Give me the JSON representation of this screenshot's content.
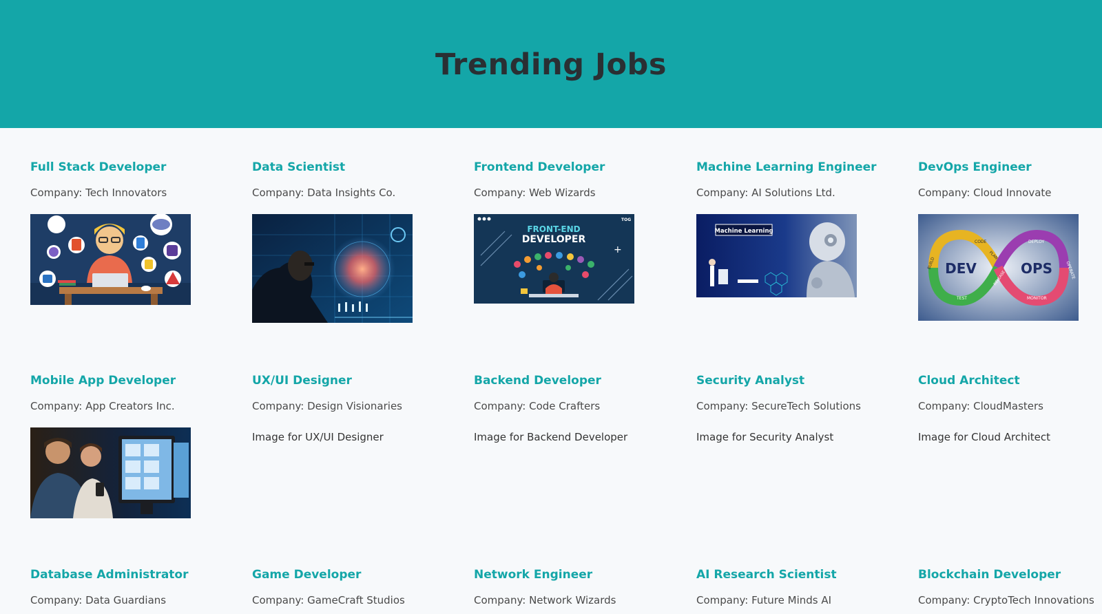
{
  "header": {
    "title": "Trending Jobs"
  },
  "jobs": [
    {
      "title": "Full Stack Developer",
      "company": "Company: Tech Innovators",
      "image": "fullstack-illustration"
    },
    {
      "title": "Data Scientist",
      "company": "Company: Data Insights Co.",
      "image": "data-scientist-photo"
    },
    {
      "title": "Frontend Developer",
      "company": "Company: Web Wizards",
      "image": "frontend-illustration",
      "image_text": {
        "line1": "FRONT-END",
        "line2": "DEVELOPER",
        "badge": "TOG"
      }
    },
    {
      "title": "Machine Learning Engineer",
      "company": "Company: AI Solutions Ltd.",
      "image": "machine-learning-photo",
      "image_text": {
        "label": "Machine Learning"
      }
    },
    {
      "title": "DevOps Engineer",
      "company": "Company: Cloud Innovate",
      "image": "devops-infinity",
      "image_text": {
        "dev": "DEV",
        "ops": "OPS",
        "code": "CODE",
        "deploy": "DEPLOY",
        "build": "BUILD",
        "operate": "OPERATE",
        "test": "TEST",
        "monitor": "MONITOR",
        "plan": "PLAN",
        "release": "RELEASE"
      }
    },
    {
      "title": "Mobile App Developer",
      "company": "Company: App Creators Inc.",
      "image": "mobile-dev-photo"
    },
    {
      "title": "UX/UI Designer",
      "company": "Company: Design Visionaries",
      "alt": "Image for UX/UI Designer"
    },
    {
      "title": "Backend Developer",
      "company": "Company: Code Crafters",
      "alt": "Image for Backend Developer"
    },
    {
      "title": "Security Analyst",
      "company": "Company: SecureTech Solutions",
      "alt": "Image for Security Analyst"
    },
    {
      "title": "Cloud Architect",
      "company": "Company: CloudMasters",
      "alt": "Image for Cloud Architect"
    },
    {
      "title": "Database Administrator",
      "company": "Company: Data Guardians"
    },
    {
      "title": "Game Developer",
      "company": "Company: GameCraft Studios"
    },
    {
      "title": "Network Engineer",
      "company": "Company: Network Wizards"
    },
    {
      "title": "AI Research Scientist",
      "company": "Company: Future Minds AI"
    },
    {
      "title": "Blockchain Developer",
      "company": "Company: CryptoTech Innovations"
    }
  ],
  "colors": {
    "header_bg": "#14a6a8",
    "title": "#14a6a8",
    "page_bg": "#f7f9fb"
  }
}
